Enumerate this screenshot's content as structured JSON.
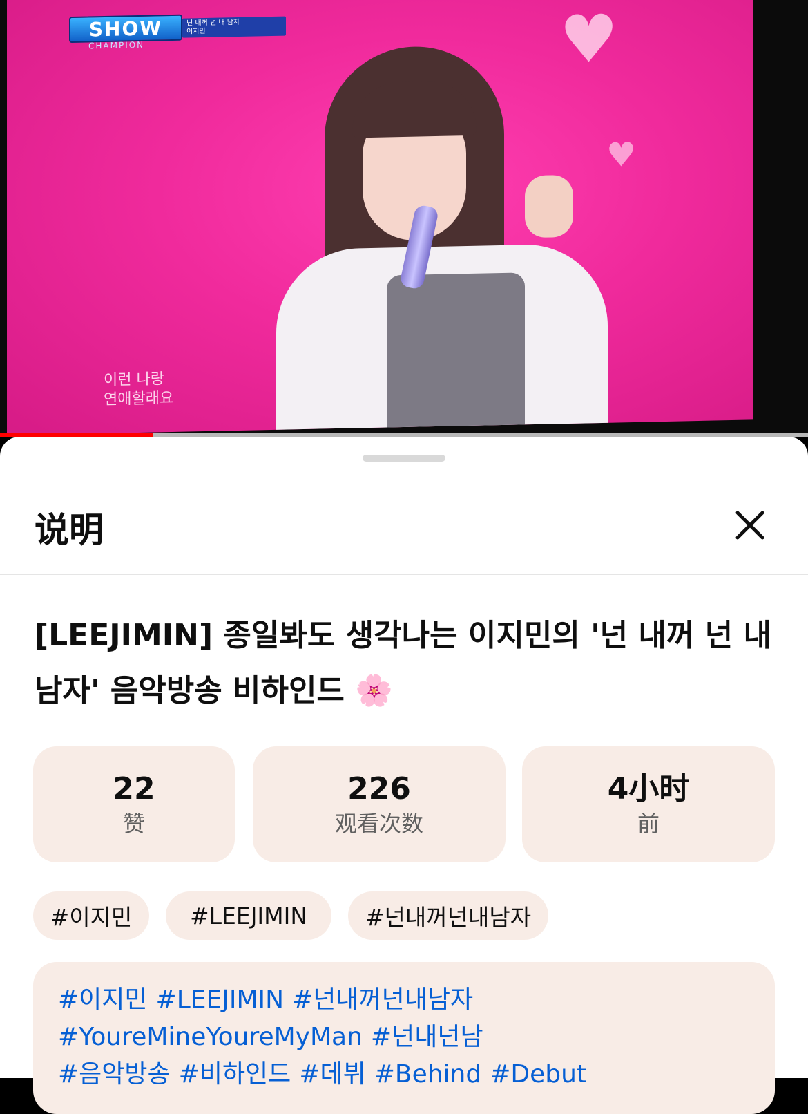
{
  "video": {
    "overlay_logo": "SHOW",
    "overlay_logo_sub": "CHAMPION",
    "overlay_song": "넌 내꺼 넌 내 남자",
    "overlay_artist": "이지민",
    "caption_line1": "이런 나랑",
    "caption_line2": "연애할래요",
    "progress_fraction": 0.19,
    "progress_color": "#ff0000"
  },
  "sheet": {
    "title": "说明",
    "close_icon": "close-icon"
  },
  "video_title": "[LEEJIMIN]  종일봐도 생각나는 이지민의 '넌 내꺼 넌 내 남자' 음악방송 비하인드 🌸",
  "stats": [
    {
      "value": "22",
      "label": "赞"
    },
    {
      "value": "226",
      "label": "观看次数"
    },
    {
      "value": "4小时",
      "label": "前"
    }
  ],
  "tags": [
    "#이지민",
    "#LEEJIMIN",
    "#넌내꺼넌내남자"
  ],
  "description_hashtags": [
    "#이지민",
    "#LEEJIMIN",
    "#넌내꺼넌내남자",
    "#YoureMineYoureMyMan",
    "#넌내넌남",
    "#음악방송",
    "#비하인드",
    "#데뷔",
    "#Behind",
    "#Debut"
  ],
  "colors": {
    "accent_bg": "#f8ece6",
    "link": "#065fd4"
  }
}
